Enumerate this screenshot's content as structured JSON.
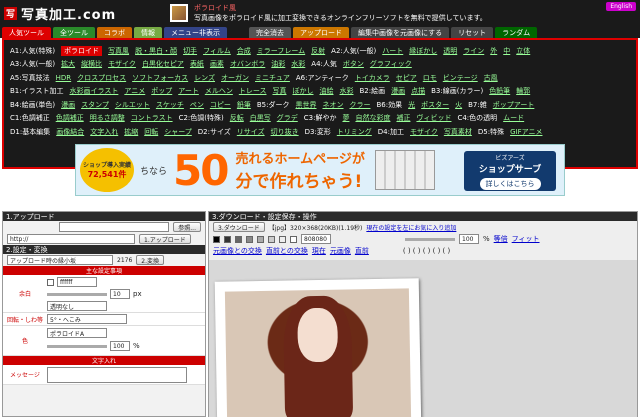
{
  "header": {
    "logo_mark": "写",
    "logo_text": "写真加工.com",
    "tag1": "ポラロイド風",
    "tag2": "写真画像をポラロイド風に加工変換できるオンラインフリーソフトを無料で提供しています。",
    "english": "English"
  },
  "tabs": [
    {
      "label": "人気ツール",
      "color": "#d00"
    },
    {
      "label": "全ツール",
      "color": "#2a8a2a"
    },
    {
      "label": "コラボ",
      "color": "#c60"
    },
    {
      "label": "情報",
      "color": "#7a4"
    },
    {
      "label": "メニュー非表示",
      "color": "#348"
    },
    {
      "label": "完全消去",
      "color": "#555"
    },
    {
      "label": "アップロード",
      "color": "#c70"
    },
    {
      "label": "編集中画像を元画像にする",
      "color": "#444"
    },
    {
      "label": "リセット",
      "color": "#444"
    },
    {
      "label": "ランダム",
      "color": "#060"
    }
  ],
  "menu_rows": [
    [
      "A1:人気(特殊)",
      "ポラロイド",
      "写真風",
      "脱・黒白・顔",
      "切手",
      "フィルム",
      "合成",
      "ミラーフレーム",
      "反射",
      "A2:人気(一般)",
      "ハート",
      "縁ぼかし",
      "透明",
      "ライン",
      "外",
      "中",
      "立体"
    ],
    [
      "A3:人気(一般)",
      "拡大",
      "縦横比",
      "モザイク",
      "白黒化セピア",
      "表紙",
      "画素",
      "オバンボラ",
      "油彩",
      "水彩",
      "A4:人気",
      "ボタン",
      "グラフィック"
    ],
    [
      "A5:写真技法",
      "HDR",
      "クロスプロセス",
      "ソフトフォーカス",
      "レンズ",
      "オーガン",
      "ミニチュア",
      "A6:アンティーク",
      "トイカメラ",
      "セピア",
      "ロモ",
      "ビンテージ",
      "古風"
    ],
    [
      "B1:イラスト加工",
      "水彩画イラスト",
      "アニメ",
      "ポップ",
      "アート",
      "メルヘン",
      "トレース",
      "写真",
      "ぼかし",
      "油絵",
      "水彩",
      "B2:絵画",
      "漫画",
      "点描",
      "B3:線画(カラー)",
      "色鉛筆",
      "輪郭"
    ],
    [
      "B4:絵画(単色)",
      "漫画",
      "スタンプ",
      "シルエット",
      "スケッチ",
      "ペン",
      "コピー",
      "鉛筆",
      "B5:ダーク",
      "黒世界",
      "ネオン",
      "クラー",
      "B6:効果",
      "光",
      "ポスター",
      "火",
      "B7:雑",
      "ポップアート"
    ],
    [
      "C1:色調補正",
      "色調補正",
      "明るさ調整",
      "コントラスト",
      "C2:色調(特殊)",
      "反転",
      "白黒写",
      "グラデ",
      "C3:鮮やか",
      "夢",
      "自然な彩度",
      "補正",
      "ヴィビッド",
      "C4:色の透明",
      "ムード"
    ],
    [
      "D1:基本編集",
      "画像結合",
      "文字入れ",
      "拡縮",
      "回転",
      "シャープ",
      "D2:サイズ",
      "リサイズ",
      "切り抜き",
      "D3:変形",
      "トリミング",
      "D4:加工",
      "モザイク",
      "写真素材",
      "D5:特殊",
      "GIFアニメ"
    ]
  ],
  "banner": {
    "badge1": "ショップ導入実績",
    "badge2": "72,541件",
    "lead": "ちなら",
    "big": "50",
    "line1": "売れるホームページが",
    "line2": "分で作れちゃう!",
    "cta1": "ビズアーズ",
    "cta2": "ショップサーブ",
    "cta3": "詳しくはこちら"
  },
  "upload": {
    "title": "1.アップロード",
    "browse": "参照...",
    "url_prefix": "http://",
    "url_value": "",
    "upload_btn": "1.アップロード"
  },
  "settings": {
    "title": "2.設定・変換",
    "preset": "アップロード時の縁小坂",
    "size": "2176",
    "convert_btn": "2.変換",
    "section_main": "主な設定事項",
    "edge_label": "余白",
    "edge_color": "ffffff",
    "edge_width": "10",
    "edge_unit": "px",
    "edge_transp": "透明なし",
    "rotate_label": "回転・しわ等",
    "rotate_value": "5°・へこみ",
    "color_label": "色",
    "color_value": "ポラロイドA",
    "opacity": "100",
    "opacity_unit": "%",
    "text_section": "文字入れ",
    "message_label": "メッセージ"
  },
  "download": {
    "title": "3.ダウンロード・設定保存・操作",
    "dl_btn": "3.ダウンロード",
    "fmt": "【jpg】320×368(20KB)(1.19秒)",
    "save_link": "現在の設定を左にお気に入り追加",
    "preview_link": "元画像との交換",
    "rounds_link": "直前との交換",
    "current": "現在",
    "orig": "元画像",
    "prev": "直前",
    "zoom": "100",
    "zoom_unit": "%",
    "equal": "等倍",
    "fit": "フィット",
    "color_hex": "808080",
    "pagination": "( ) ( ) ( ) ( ) ( )"
  }
}
